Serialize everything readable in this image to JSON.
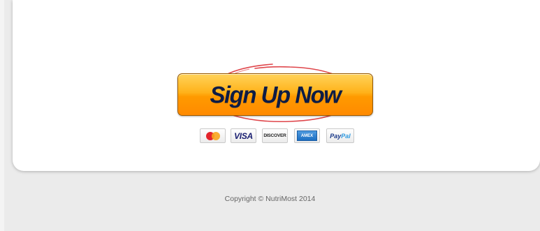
{
  "signup": {
    "label": "Sign Up Now"
  },
  "payment_methods": [
    {
      "name": "MasterCard",
      "icon": "mastercard-icon",
      "label": ""
    },
    {
      "name": "Visa",
      "icon": "visa-icon",
      "label": "VISA"
    },
    {
      "name": "Discover",
      "icon": "discover-icon",
      "label": "DISCOVER"
    },
    {
      "name": "American Express",
      "icon": "amex-icon",
      "label": "AMEX"
    },
    {
      "name": "PayPal",
      "icon": "paypal-icon",
      "label_a": "Pay",
      "label_b": "Pal"
    }
  ],
  "footer": {
    "copyright": "Copyright © NutriMost 2014"
  },
  "colors": {
    "button_top": "#ffd35a",
    "button_bottom": "#ff8a00",
    "button_text": "#0d1c45",
    "swoosh": "#d9262b",
    "page_bg": "#ebebeb",
    "card_bg": "#ffffff"
  }
}
